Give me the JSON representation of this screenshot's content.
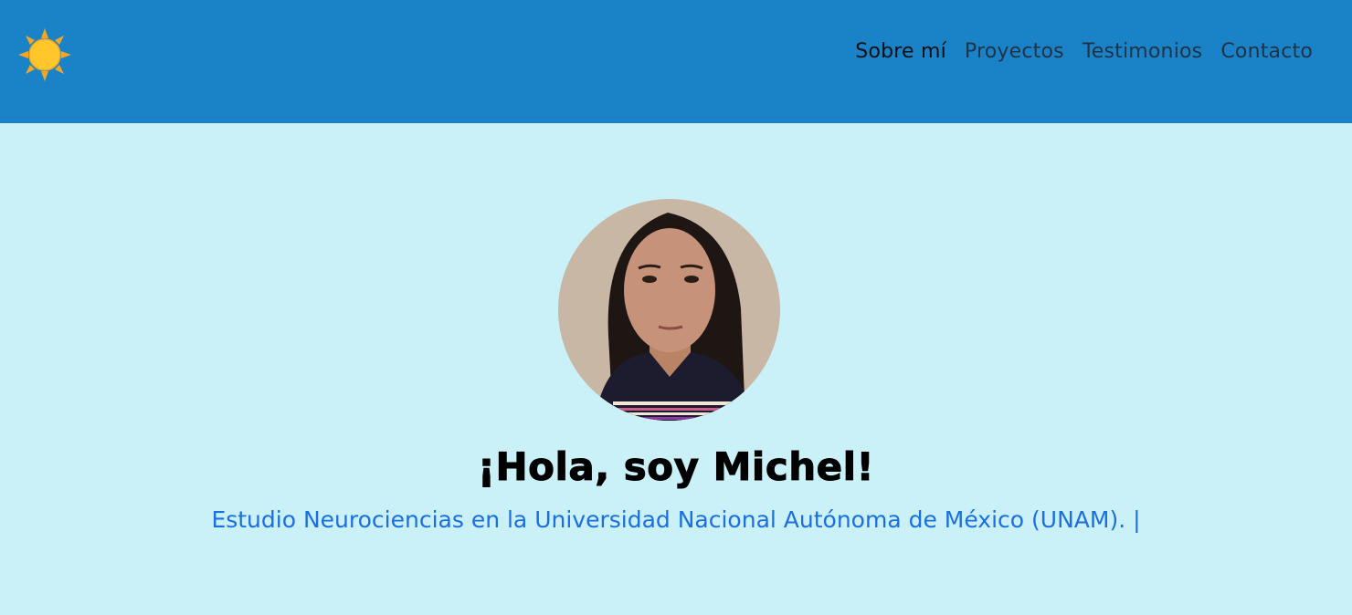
{
  "header": {
    "logo_icon": "sun-icon",
    "nav": [
      {
        "label": "Sobre mí",
        "active": true
      },
      {
        "label": "Proyectos",
        "active": false
      },
      {
        "label": "Testimonios",
        "active": false
      },
      {
        "label": "Contacto",
        "active": false
      }
    ]
  },
  "hero": {
    "title": "¡Hola, soy Michel!",
    "subtitle": "Estudio Neurociencias en la Universidad Nacional Autónoma de México (UNAM).",
    "cursor": "|"
  },
  "colors": {
    "navbar": "#1a82c7",
    "background": "#caf0f8",
    "subtitle": "#1b6fe0",
    "sun": "#ffc72c"
  }
}
